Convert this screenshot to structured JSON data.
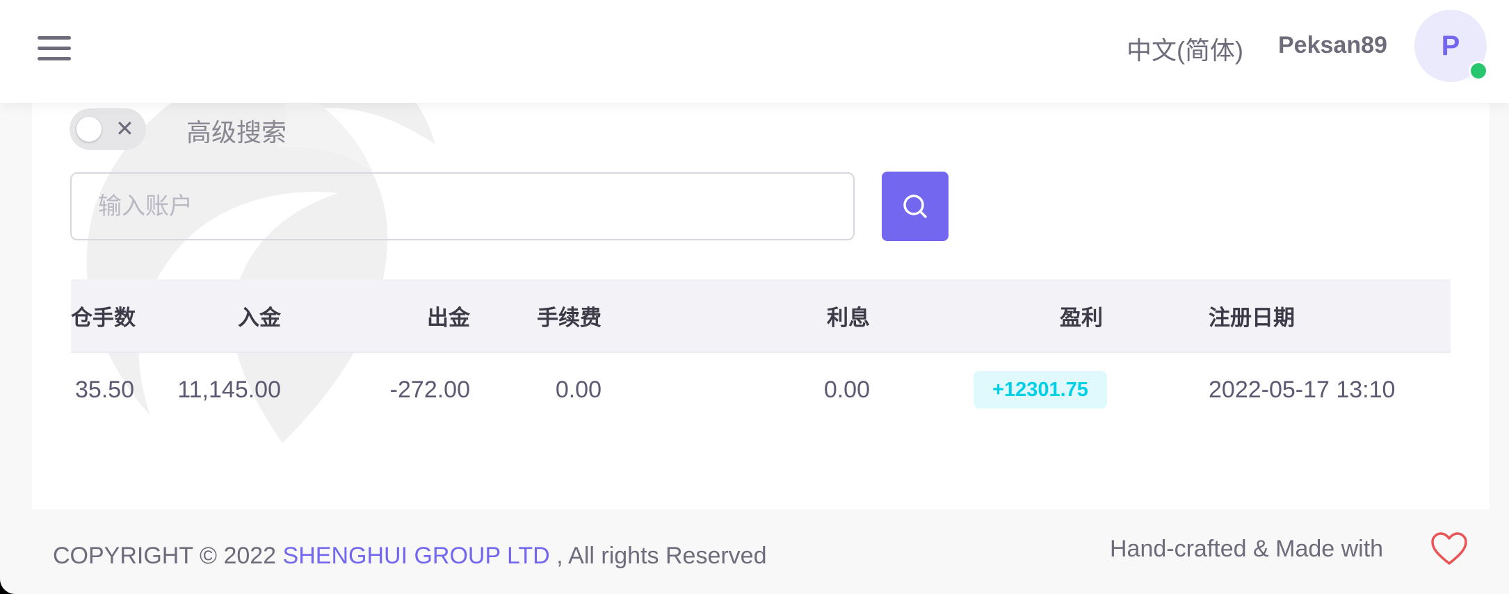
{
  "header": {
    "language": "中文(简体)",
    "username": "Peksan89",
    "avatar_initial": "P",
    "status_color": "#28c76f"
  },
  "filters": {
    "advanced_search_label": "高级搜索",
    "advanced_search_enabled": false,
    "account_placeholder": "输入账户"
  },
  "table": {
    "columns": [
      "仓手数",
      "入金",
      "出金",
      "手续费",
      "利息",
      "盈利",
      "注册日期"
    ],
    "rows": [
      {
        "lots": "35.50",
        "deposit": "11,145.00",
        "withdrawal": "-272.00",
        "fee": "0.00",
        "interest": "0.00",
        "profit": "+12301.75",
        "register_date": "2022-05-17 13:10"
      }
    ]
  },
  "footer": {
    "copyright_prefix": "COPYRIGHT © 2022 ",
    "company": "SHENGHUI GROUP LTD",
    "rights_suffix": ", All rights Reserved",
    "made_with": "Hand-crafted & Made with"
  },
  "colors": {
    "primary": "#7367f0",
    "profit_badge_bg": "#e0f9fc",
    "profit_badge_text": "#00cfe8",
    "heart": "#ea5455"
  }
}
